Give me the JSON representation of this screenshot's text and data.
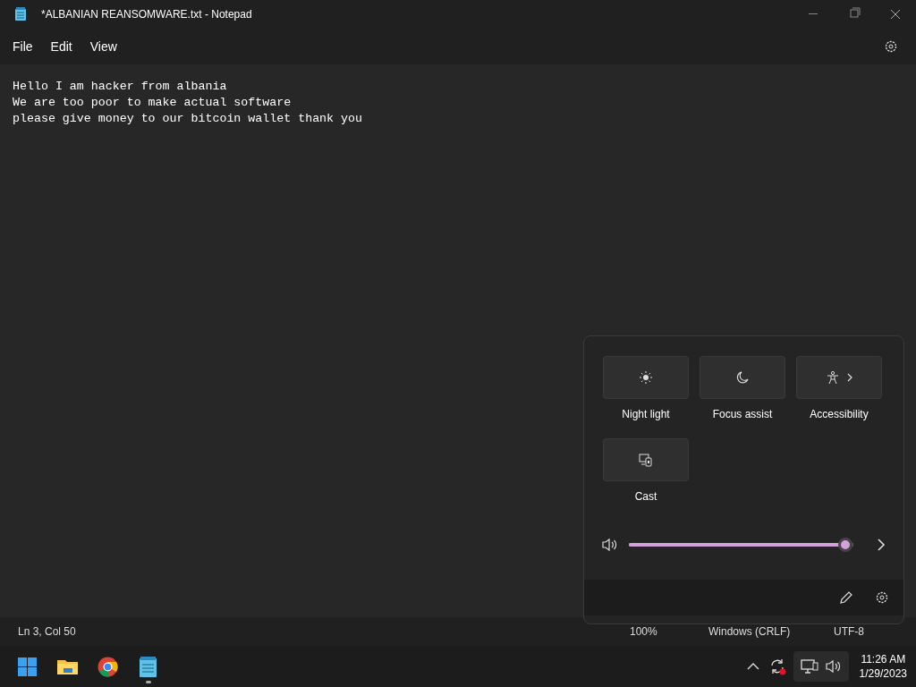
{
  "window": {
    "title": "*ALBANIAN REANSOMWARE.txt - Notepad"
  },
  "menu": [
    "File",
    "Edit",
    "View"
  ],
  "editor": {
    "lines": [
      "Hello I am hacker from albania",
      "We are too poor to make actual software",
      "please give money to our bitcoin wallet thank you"
    ]
  },
  "status_bar": {
    "position": "Ln 3, Col 50",
    "zoom": "100%",
    "line_endings": "Windows (CRLF)",
    "encoding": "UTF-8"
  },
  "quick_settings": {
    "tiles": [
      {
        "label": "Night light",
        "kind": "sun",
        "on": false,
        "has_submenu": false
      },
      {
        "label": "Focus assist",
        "kind": "moon",
        "on": false,
        "has_submenu": false
      },
      {
        "label": "Accessibility",
        "kind": "person",
        "on": false,
        "has_submenu": true
      },
      {
        "label": "Cast",
        "kind": "cast",
        "on": false,
        "has_submenu": false
      }
    ],
    "volume": {
      "level": 0.97
    }
  },
  "taskbar": {
    "apps": [
      {
        "kind": "start",
        "running": false
      },
      {
        "kind": "folder",
        "running": false
      },
      {
        "kind": "browser",
        "running": false
      },
      {
        "kind": "notepad",
        "running": true
      }
    ],
    "time": "11:26 AM",
    "date": "1/29/2023"
  }
}
